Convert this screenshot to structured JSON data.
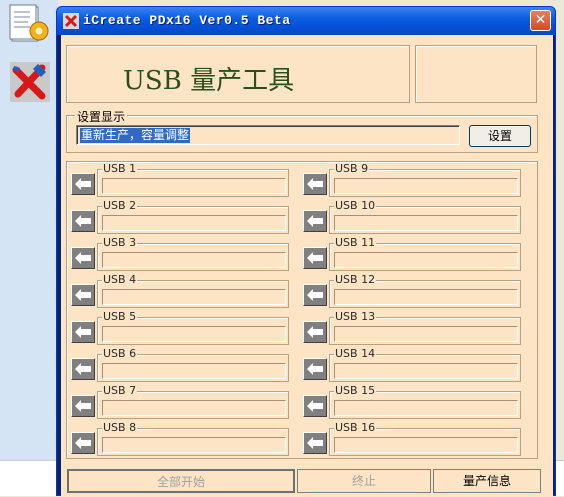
{
  "window": {
    "title": "iCreate PDx16 Ver0.5 Beta",
    "close_label": "✕"
  },
  "banner": {
    "title": "USB 量产工具"
  },
  "settings": {
    "legend": "设置显示",
    "value": "重新生产，容量调整",
    "button_label": "设置"
  },
  "usb_ports": [
    {
      "label": "USB 1",
      "status": ""
    },
    {
      "label": "USB 2",
      "status": ""
    },
    {
      "label": "USB 3",
      "status": ""
    },
    {
      "label": "USB 4",
      "status": ""
    },
    {
      "label": "USB 5",
      "status": ""
    },
    {
      "label": "USB 6",
      "status": ""
    },
    {
      "label": "USB 7",
      "status": ""
    },
    {
      "label": "USB 8",
      "status": ""
    },
    {
      "label": "USB 9",
      "status": ""
    },
    {
      "label": "USB 10",
      "status": ""
    },
    {
      "label": "USB 11",
      "status": ""
    },
    {
      "label": "USB 12",
      "status": ""
    },
    {
      "label": "USB 13",
      "status": ""
    },
    {
      "label": "USB 14",
      "status": ""
    },
    {
      "label": "USB 15",
      "status": ""
    },
    {
      "label": "USB 16",
      "status": ""
    }
  ],
  "buttons": {
    "start_all": "全部开始",
    "stop": "终止",
    "production_info": "量产信息"
  },
  "colors": {
    "client_background": "#fde4c5",
    "titlebar": "#0551d8",
    "selection": "#316ac5",
    "banner_text": "#2a4f1a"
  }
}
